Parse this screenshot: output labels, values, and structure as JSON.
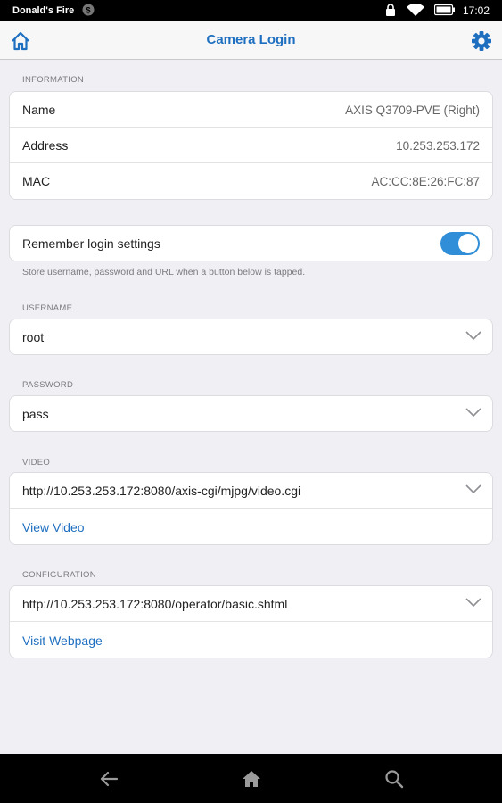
{
  "status_bar": {
    "device_name": "Donald's Fire",
    "time": "17:02"
  },
  "nav": {
    "title": "Camera Login",
    "home_icon": "home-icon",
    "settings_icon": "gear-icon"
  },
  "information": {
    "header": "INFORMATION",
    "rows": [
      {
        "label": "Name",
        "value": "AXIS Q3709-PVE (Right)"
      },
      {
        "label": "Address",
        "value": "10.253.253.172"
      },
      {
        "label": "MAC",
        "value": "AC:CC:8E:26:FC:87"
      }
    ]
  },
  "remember": {
    "label": "Remember login settings",
    "enabled": true,
    "hint": "Store username, password and URL when a button below is tapped."
  },
  "username": {
    "header": "USERNAME",
    "value": "root"
  },
  "password": {
    "header": "PASSWORD",
    "value": "pass"
  },
  "video": {
    "header": "VIDEO",
    "url": "http://10.253.253.172:8080/axis-cgi/mjpg/video.cgi",
    "action": "View Video"
  },
  "configuration": {
    "header": "CONFIGURATION",
    "url": "http://10.253.253.172:8080/operator/basic.shtml",
    "action": "Visit Webpage"
  },
  "colors": {
    "accent": "#1e6fc0",
    "toggle_on": "#2f8ed7",
    "background": "#efeff4"
  }
}
